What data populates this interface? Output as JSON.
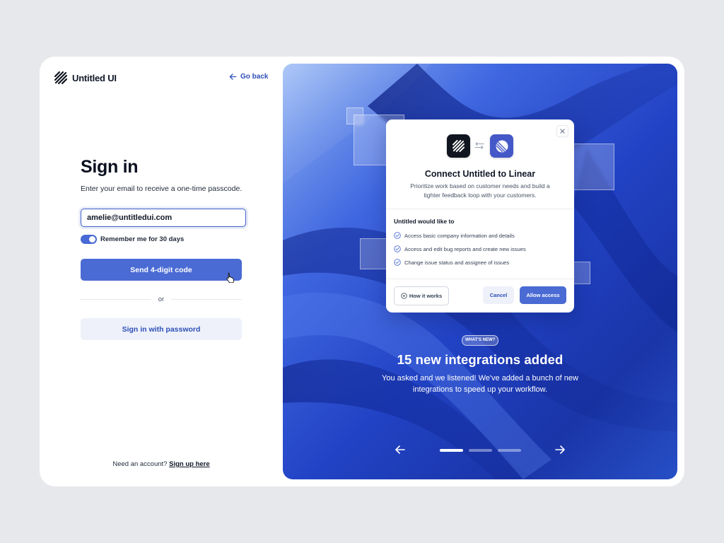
{
  "brand": {
    "name": "Untitled UI"
  },
  "header": {
    "back_label": "Go back"
  },
  "signin": {
    "title": "Sign in",
    "subtitle": "Enter your email to receive a one-time passcode.",
    "email_value": "amelie@untitledui.com",
    "remember_label": "Remember me for 30 days",
    "remember_on": true,
    "send_label": "Send 4-digit code",
    "divider": "or",
    "password_label": "Sign in with password",
    "no_account": "Need an account?",
    "signup_link": "Sign up here"
  },
  "dialog": {
    "title": "Connect Untitled to Linear",
    "description": "Prioritize work based on customer needs and build a tighter feedback loop with your customers.",
    "permissions_heading": "Untitled would like to",
    "permissions": [
      "Access basic company information and details",
      "Access and edit bug reports and create new issues",
      "Change issue status and assignee of issues"
    ],
    "how_label": "How it works",
    "cancel_label": "Cancel",
    "allow_label": "Allow access"
  },
  "promo": {
    "badge": "WHAT'S NEW?",
    "title": "15 new integrations added",
    "body": "You asked and we listened! We've added a bunch of new integrations to speed up your workflow.",
    "slide_count": 3,
    "active_slide": 1
  },
  "colors": {
    "primary": "#4a6bd4",
    "primary_text": "#2e4fb8",
    "secondary_bg": "#eef1f9",
    "page_bg": "#e7e8eb"
  },
  "icons": [
    "logo-mark-icon",
    "arrow-left-icon",
    "pointer-cursor-icon",
    "close-icon",
    "swap-arrows-icon",
    "check-circle-icon",
    "play-circle-icon",
    "arrow-right-icon"
  ]
}
